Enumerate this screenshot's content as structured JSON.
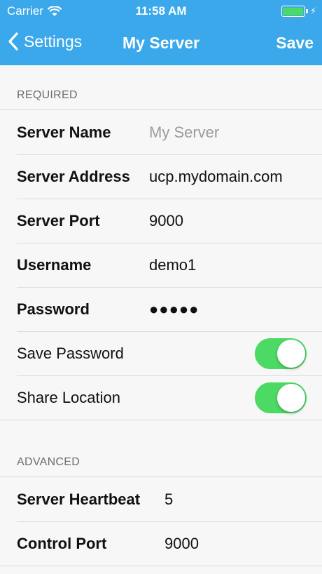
{
  "status_bar": {
    "carrier": "Carrier",
    "time": "11:58 AM"
  },
  "nav": {
    "back_label": "Settings",
    "title": "My Server",
    "save_label": "Save"
  },
  "sections": {
    "required": {
      "header": "REQUIRED",
      "server_name": {
        "label": "Server Name",
        "placeholder": "My Server"
      },
      "server_address": {
        "label": "Server Address",
        "value": "ucp.mydomain.com"
      },
      "server_port": {
        "label": "Server Port",
        "value": "9000"
      },
      "username": {
        "label": "Username",
        "value": "demo1"
      },
      "password": {
        "label": "Password",
        "value": "●●●●●"
      },
      "save_password": {
        "label": "Save Password",
        "on": true
      },
      "share_location": {
        "label": "Share Location",
        "on": true
      }
    },
    "advanced": {
      "header": "ADVANCED",
      "server_heartbeat": {
        "label": "Server Heartbeat",
        "value": "5"
      },
      "control_port": {
        "label": "Control Port",
        "value": "9000"
      }
    }
  },
  "colors": {
    "nav_background": "#3aa8ea",
    "toggle_on": "#4cd964",
    "page_background": "#f7f7f7"
  }
}
